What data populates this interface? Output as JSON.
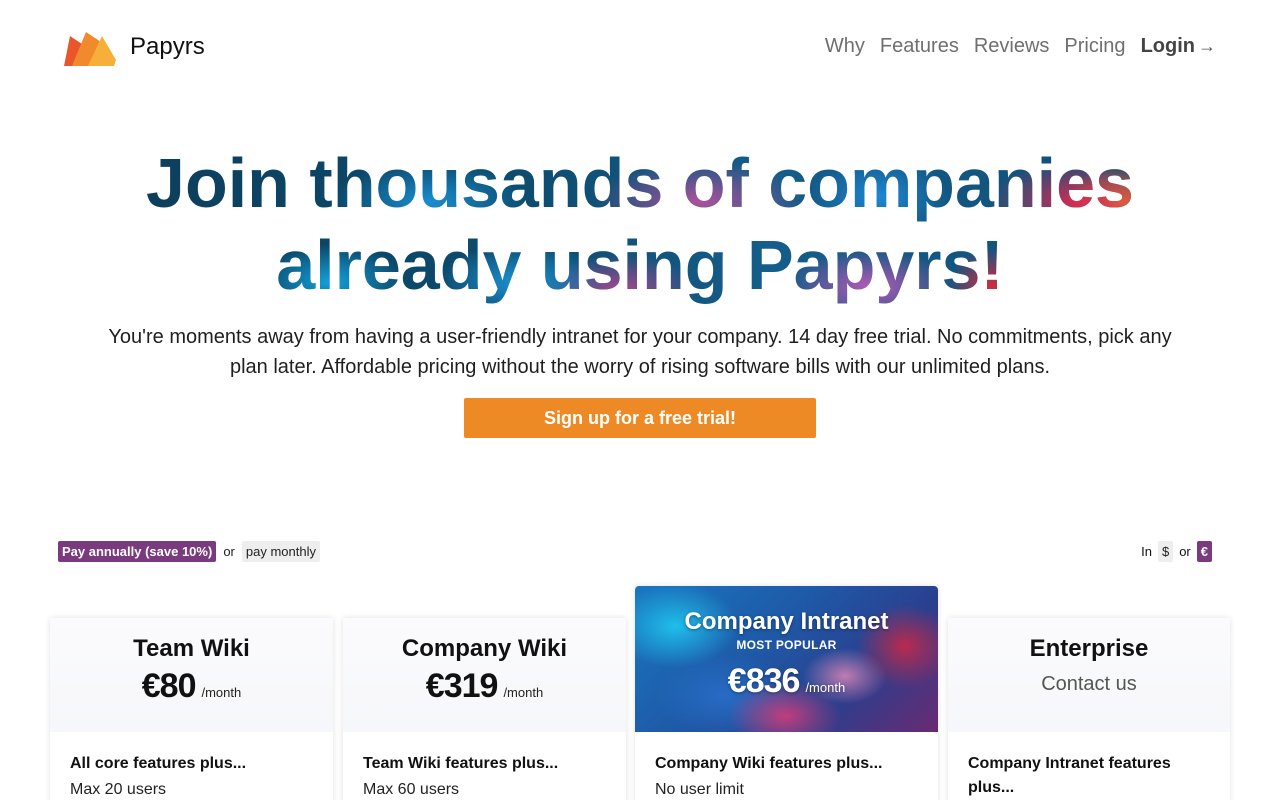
{
  "header": {
    "brand": "Papyrs",
    "nav": [
      "Why",
      "Features",
      "Reviews",
      "Pricing"
    ],
    "login_label": "Login",
    "login_arrow": "→"
  },
  "hero": {
    "title_line1": "Join thousands of companies",
    "title_line2": "already using Papyrs!",
    "subtitle": "You're moments away from having a user-friendly intranet for your company. 14 day free trial. No commitments, pick any plan later. Affordable pricing without the worry of rising software bills with our unlimited plans.",
    "cta_label": "Sign up for a free trial!"
  },
  "billing": {
    "annual_label": "Pay annually (save 10%)",
    "or": "or",
    "monthly_label": "pay monthly"
  },
  "currency": {
    "prefix": "In",
    "usd": "$",
    "or": "or",
    "eur": "€"
  },
  "plans": [
    {
      "title": "Team Wiki",
      "price": "€80",
      "per": "/month",
      "lead": "All core features plus...",
      "feature": "Max 20 users"
    },
    {
      "title": "Company Wiki",
      "price": "€319",
      "per": "/month",
      "lead": "Team Wiki features plus...",
      "feature": "Max 60 users"
    },
    {
      "title": "Company Intranet",
      "badge": "MOST POPULAR",
      "price": "€836",
      "per": "/month",
      "lead": "Company Wiki features plus...",
      "feature": "No user limit"
    },
    {
      "title": "Enterprise",
      "contact": "Contact us",
      "lead": "Company Intranet features plus..."
    }
  ],
  "colors": {
    "accent_orange": "#ee8a25",
    "toggle_purple": "#7a3a7e"
  }
}
